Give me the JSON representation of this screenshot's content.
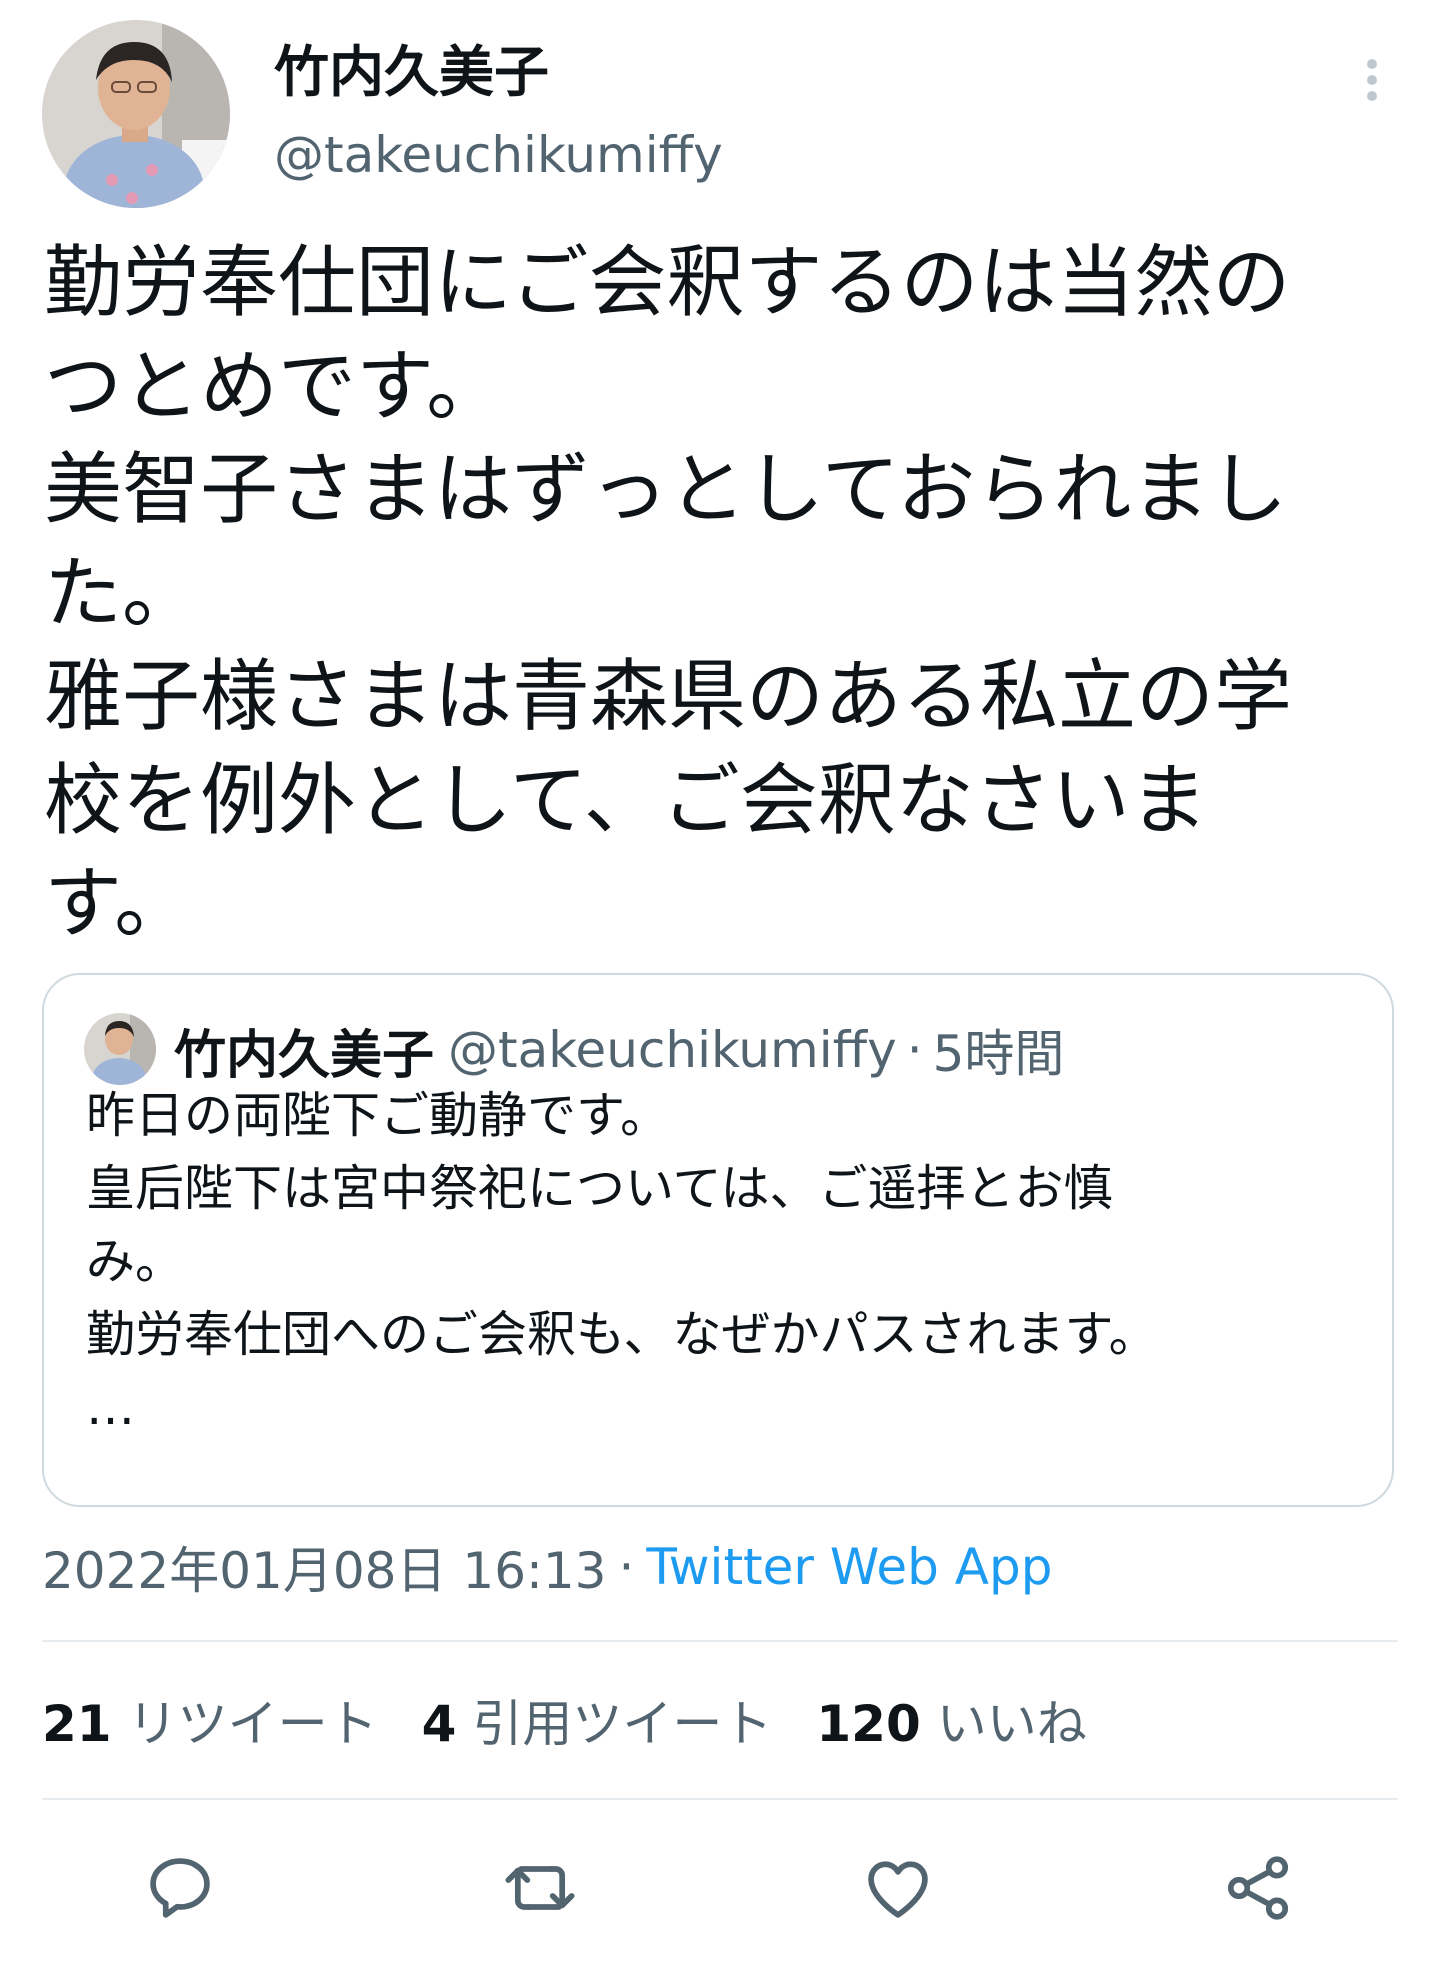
{
  "tweet": {
    "author": {
      "name": "竹内久美子",
      "handle": "@takeuchikumiffy"
    },
    "text_lines": [
      "勤労奉仕団にご会釈するのは当然の",
      "つとめです。",
      "美智子さまはずっとしておられまし",
      "た。",
      "雅子様さまは青森県のある私立の学",
      "校を例外として、ご会釈なさいま",
      "す。"
    ],
    "datetime": "2022年01月08日 16:13",
    "separator": "·",
    "source": "Twitter Web App"
  },
  "quoted_tweet": {
    "name": "竹内久美子",
    "handle": "@takeuchikumiffy",
    "separator": "·",
    "time": "5時間",
    "text_lines": [
      "昨日の両陛下ご動静です。",
      "皇后陛下は宮中祭祀については、ご遥拝とお慎",
      "み。",
      "勤労奉仕団へのご会釈も、なぜかパスされます。",
      "…"
    ]
  },
  "stats": [
    {
      "count": "21",
      "label": "リツイート"
    },
    {
      "count": "4",
      "label": "引用ツイート"
    },
    {
      "count": "120",
      "label": "いいね"
    }
  ],
  "icons": {
    "more": "more-vertical-icon",
    "reply": "reply-icon",
    "retweet": "retweet-icon",
    "like": "heart-icon",
    "share": "share-icon"
  },
  "colors": {
    "accent": "#1d9bf0",
    "secondary_text": "#536471",
    "border": "#cfd9de"
  }
}
